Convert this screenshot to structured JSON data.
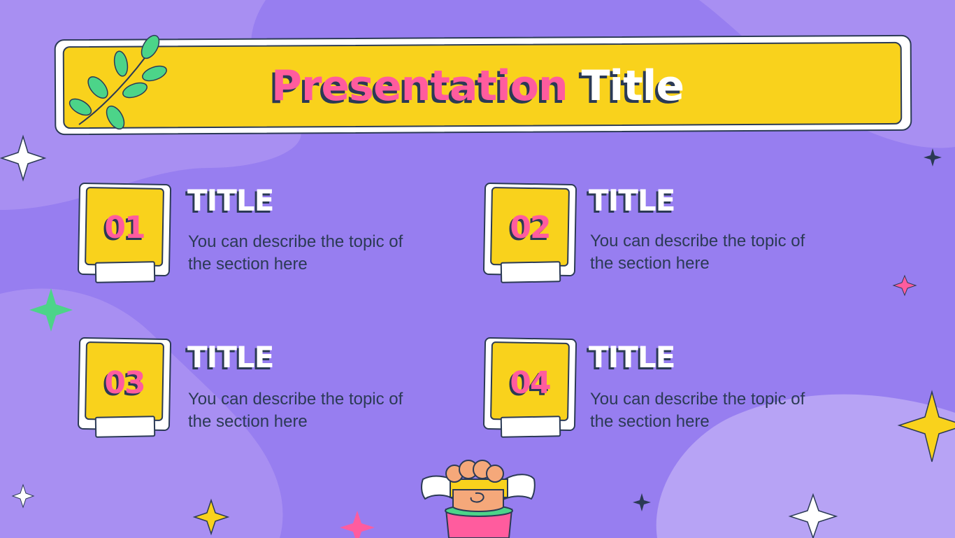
{
  "title": {
    "part1": "Presentation",
    "part2": "Title"
  },
  "items": [
    {
      "number": "01",
      "title": "TITLE",
      "description": "You can describe the topic of the section here"
    },
    {
      "number": "02",
      "title": "TITLE",
      "description": "You can describe the topic of the section here"
    },
    {
      "number": "03",
      "title": "TITLE",
      "description": "You can describe the topic of the section here"
    },
    {
      "number": "04",
      "title": "TITLE",
      "description": "You can describe the topic of the section here"
    }
  ],
  "colors": {
    "background": "#977ef0",
    "banner": "#f9d21c",
    "accent_pink": "#ff5c9e",
    "outline": "#2b3a55",
    "leaf_green": "#4cd489"
  }
}
